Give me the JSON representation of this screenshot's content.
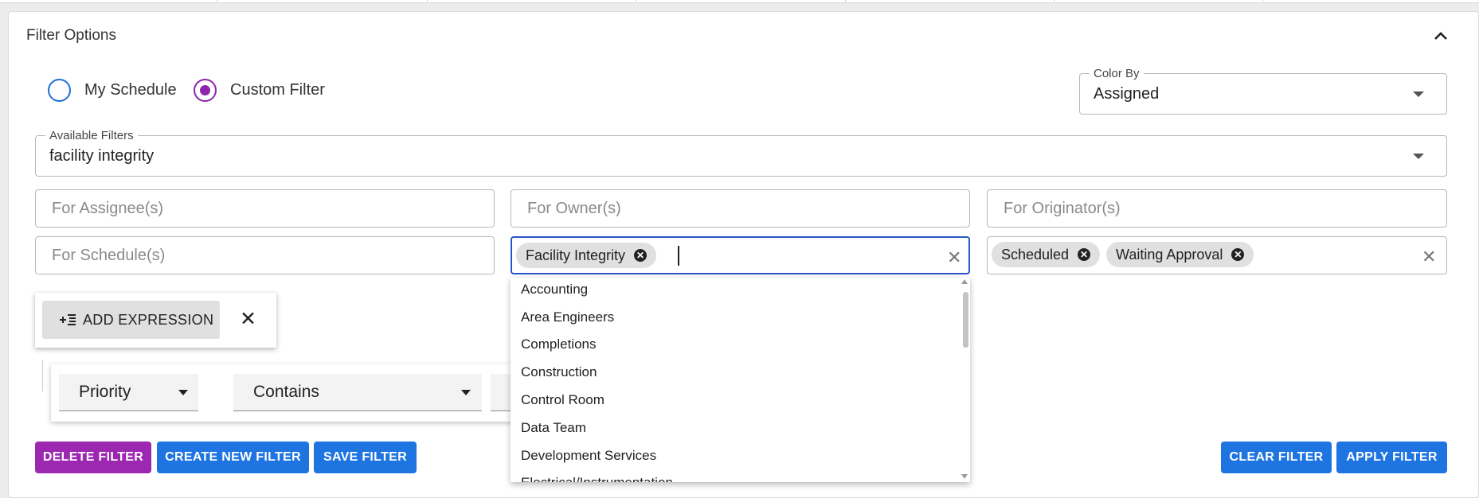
{
  "panel": {
    "title": "Filter Options"
  },
  "schedule_mode": {
    "options": [
      {
        "label": "My Schedule",
        "checked": false
      },
      {
        "label": "Custom Filter",
        "checked": true
      }
    ]
  },
  "color_by": {
    "label": "Color By",
    "value": "Assigned"
  },
  "available_filters": {
    "label": "Available Filters",
    "value": "facility integrity"
  },
  "fields": {
    "assignee_placeholder": "For Assignee(s)",
    "owner_placeholder": "For Owner(s)",
    "originator_placeholder": "For Originator(s)",
    "schedule_placeholder": "For Schedule(s)"
  },
  "group_field": {
    "chips": [
      "Facility Integrity"
    ]
  },
  "status_field": {
    "chips": [
      "Scheduled",
      "Waiting Approval"
    ]
  },
  "dropdown": {
    "options": [
      "Accounting",
      "Area Engineers",
      "Completions",
      "Construction",
      "Control Room",
      "Data Team",
      "Development Services",
      "Electrical/Instrumentation"
    ]
  },
  "expression": {
    "add_label": "ADD EXPRESSION",
    "field": "Priority",
    "operator": "Contains"
  },
  "buttons": {
    "delete": "DELETE FILTER",
    "create": "CREATE NEW FILTER",
    "save": "SAVE FILTER",
    "clear": "CLEAR FILTER",
    "apply": "APPLY FILTER"
  },
  "colors": {
    "accent_purple": "#9c27b0",
    "primary_blue": "#1e74e0",
    "focus_blue": "#2a55c8"
  }
}
